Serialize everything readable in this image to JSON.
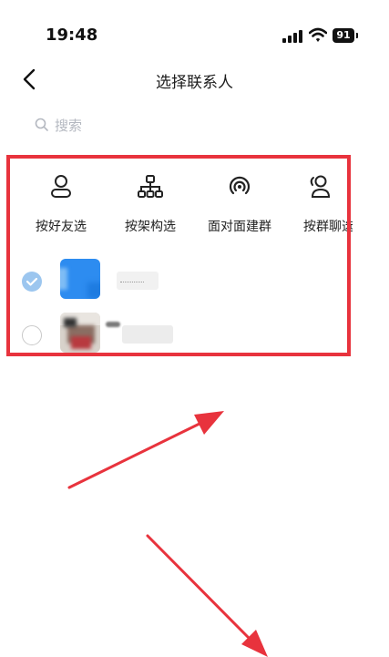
{
  "status_bar": {
    "time": "19:48",
    "battery": "91"
  },
  "nav": {
    "title": "选择联系人"
  },
  "search": {
    "placeholder": "搜索"
  },
  "quick_actions": [
    {
      "label": "按好友选",
      "icon": "person-icon"
    },
    {
      "label": "按架构选",
      "icon": "org-chart-icon"
    },
    {
      "label": "面对面建群",
      "icon": "nearby-signal-icon"
    },
    {
      "label": "按群聊选",
      "icon": "group-person-icon"
    }
  ],
  "contacts": [
    {
      "selected": true
    },
    {
      "selected": false
    }
  ],
  "colors": {
    "annotation": "#e8333d",
    "checked": "#9cc6ef",
    "accent_blue": "#2d8cf0"
  }
}
